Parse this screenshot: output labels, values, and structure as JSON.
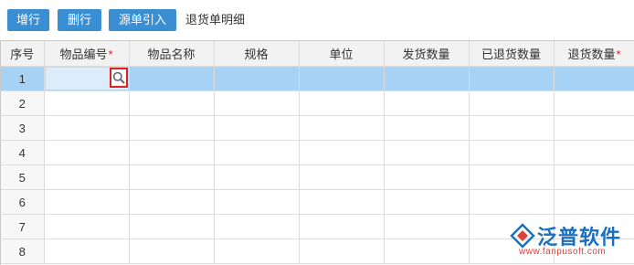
{
  "toolbar": {
    "add_row_label": "增行",
    "delete_row_label": "删行",
    "import_label": "源单引入",
    "section_title": "退货单明细"
  },
  "grid": {
    "columns": [
      {
        "label": "序号",
        "required": false
      },
      {
        "label": "物品编号",
        "required": true
      },
      {
        "label": "物品名称",
        "required": false
      },
      {
        "label": "规格",
        "required": false
      },
      {
        "label": "单位",
        "required": false
      },
      {
        "label": "发货数量",
        "required": false
      },
      {
        "label": "已退货数量",
        "required": false
      },
      {
        "label": "退货数量",
        "required": true
      }
    ],
    "required_mark": "*",
    "rows": [
      "1",
      "2",
      "3",
      "4",
      "5",
      "6",
      "7",
      "8"
    ],
    "selected_row": "1"
  },
  "icons": {
    "lookup": "search-icon"
  },
  "watermark": {
    "brand_name": "泛普软件",
    "url": "www.fanpusoft.com",
    "brand_color": "#1a6fc0",
    "url_color": "#e0403a"
  },
  "colors": {
    "button": "#3a8fd4",
    "selected_row": "#a6d2f5",
    "required": "#e02020",
    "lookup_highlight": "#e02020"
  }
}
